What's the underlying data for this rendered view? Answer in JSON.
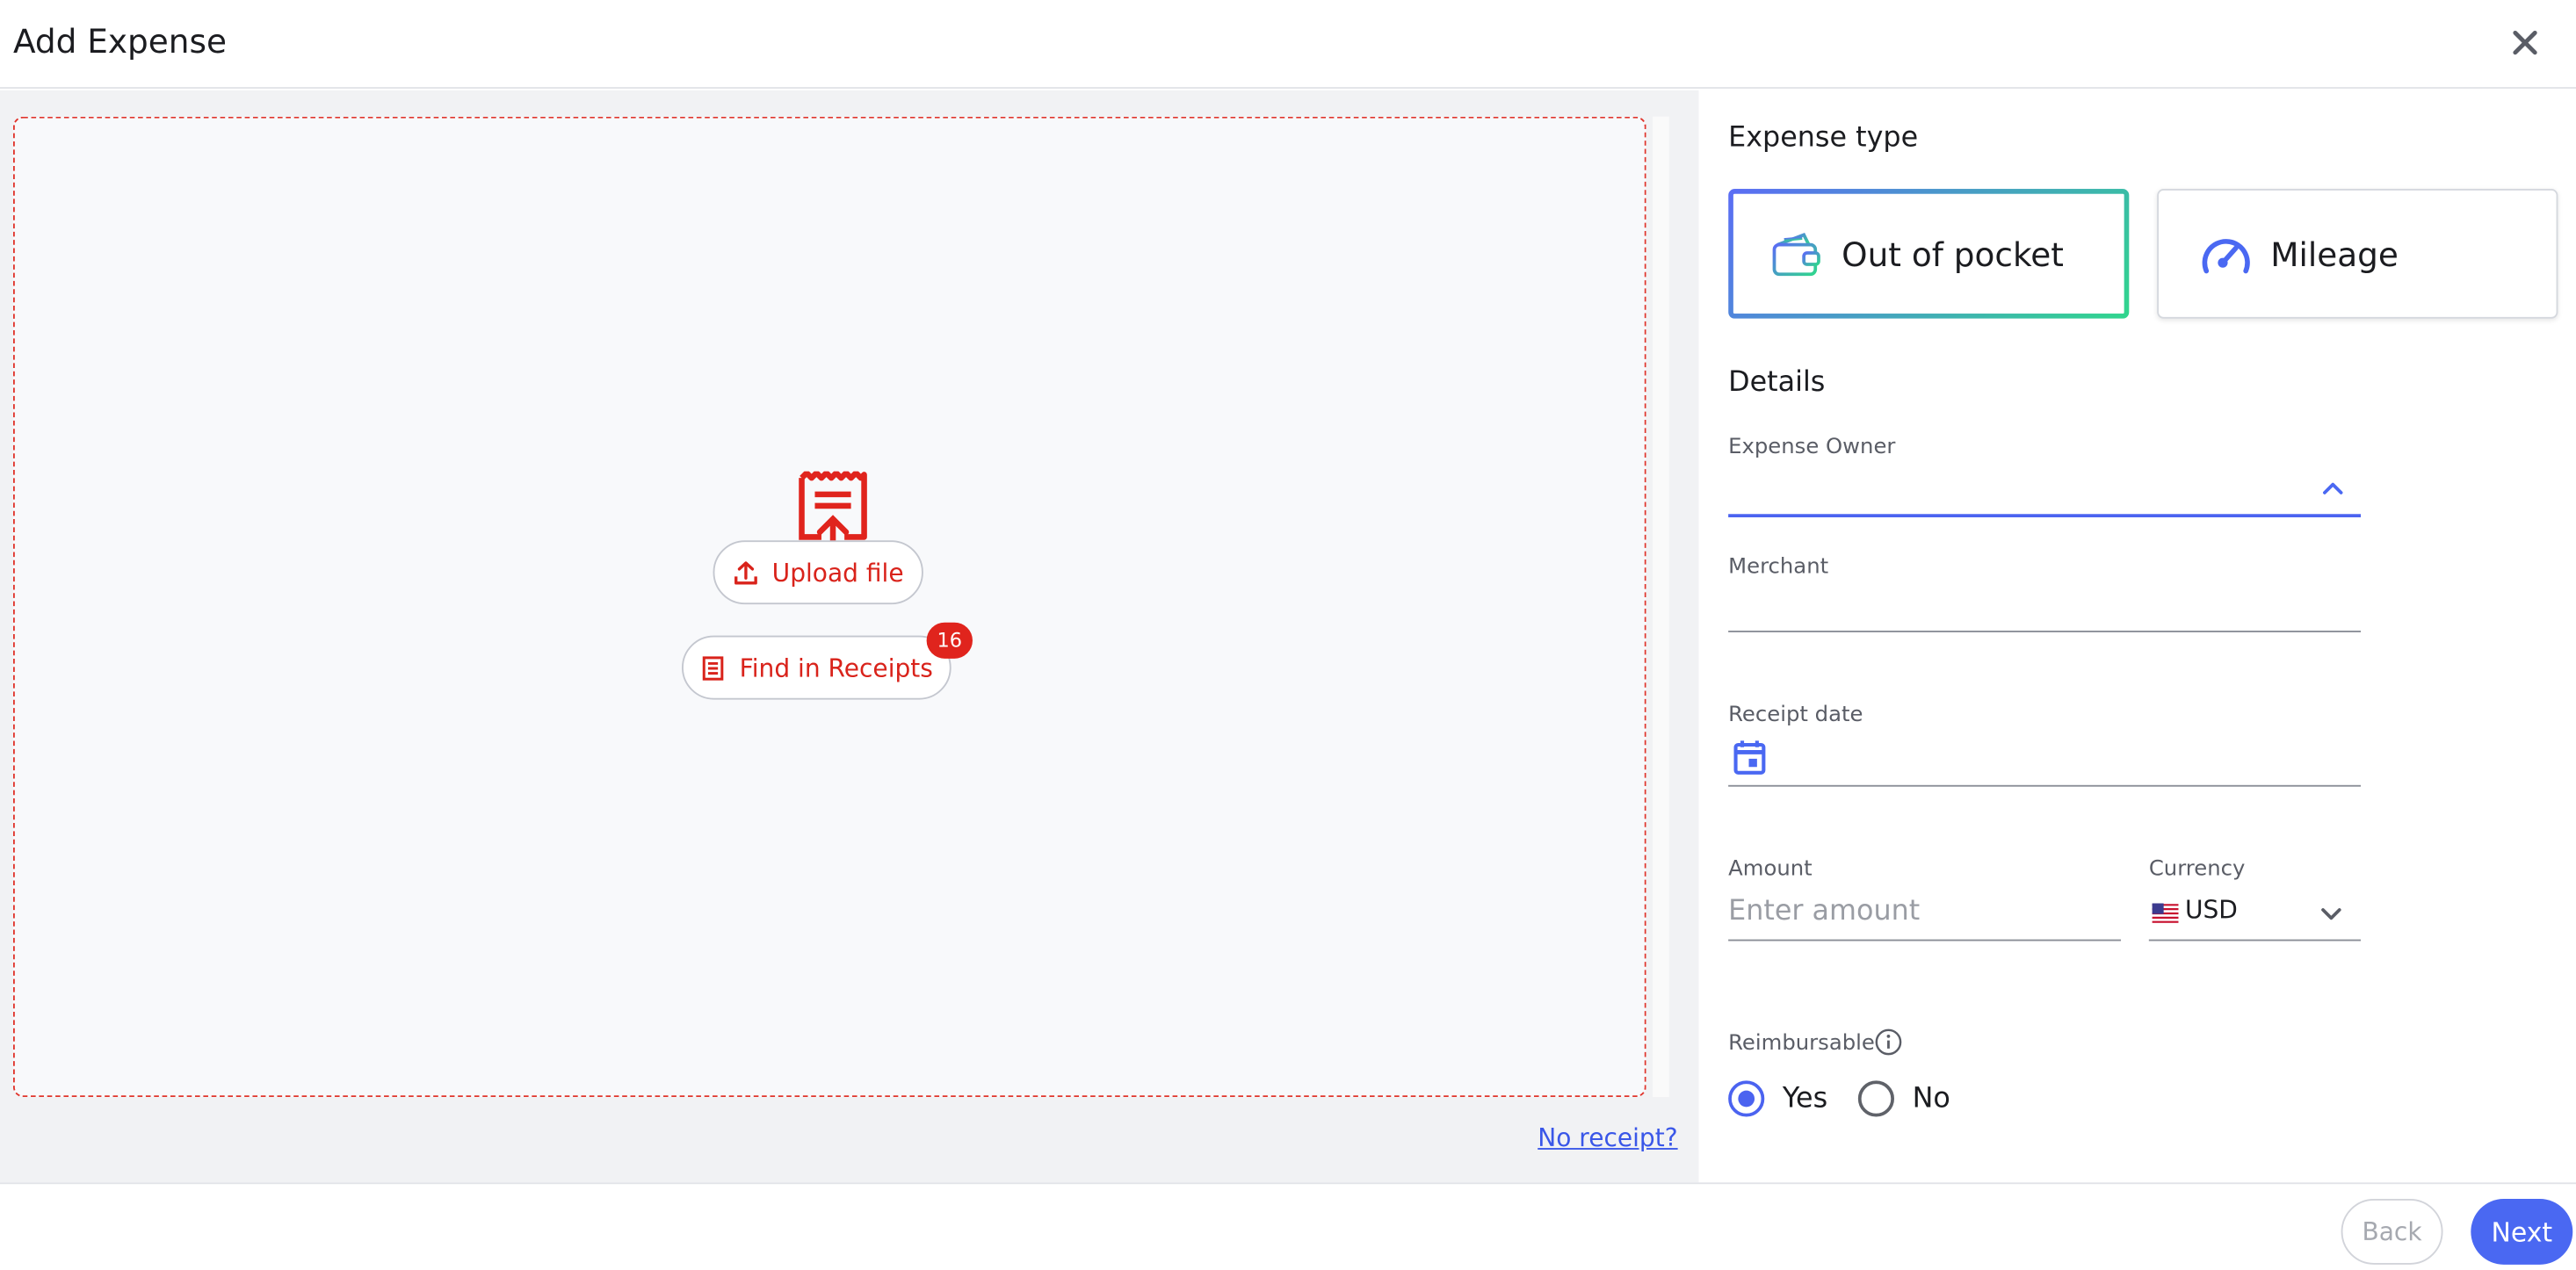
{
  "header": {
    "title": "Add Expense",
    "close_icon": "close-icon"
  },
  "left_pane": {
    "upload_button": "Upload file",
    "find_button": "Find in Receipts",
    "find_badge": "16",
    "no_receipt_link": "No receipt?",
    "accent_color": "#e0241d"
  },
  "right_pane": {
    "expense_type_title": "Expense type",
    "types": [
      {
        "label": "Out of pocket",
        "icon": "wallet-icon",
        "selected": true
      },
      {
        "label": "Mileage",
        "icon": "speedometer-icon",
        "selected": false
      }
    ],
    "details_title": "Details",
    "fields": {
      "expense_owner": {
        "label": "Expense Owner",
        "value": ""
      },
      "merchant": {
        "label": "Merchant",
        "value": ""
      },
      "receipt_date": {
        "label": "Receipt date",
        "value": ""
      },
      "amount": {
        "label": "Amount",
        "placeholder": "Enter amount"
      },
      "currency": {
        "label": "Currency",
        "value": "USD",
        "flag": "us-flag-icon"
      }
    },
    "reimbursable": {
      "label": "Reimbursable",
      "options": [
        {
          "label": "Yes",
          "checked": true
        },
        {
          "label": "No",
          "checked": false
        }
      ]
    }
  },
  "footer": {
    "back": "Back",
    "next": "Next",
    "primary_color": "#4a68f2"
  }
}
